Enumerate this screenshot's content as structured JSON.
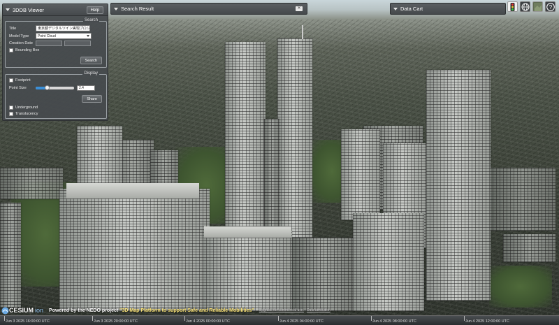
{
  "viewer": {
    "title": "3DDB Viewer",
    "help_label": "Help",
    "search": {
      "legend": "Search",
      "title_label": "Title",
      "title_value": "東京都デジタルツイン実現プロジェ",
      "model_type_label": "Model Type",
      "model_type_value": "Point Cloud",
      "creation_date_label": "Creation Date",
      "bounding_box_label": "Bounding Box",
      "search_button": "Search"
    },
    "display": {
      "legend": "Display",
      "footprint_label": "Footprint",
      "point_size_label": "Point Size",
      "point_size_value": "2.4",
      "point_size_fraction": 0.3,
      "share_button": "Share",
      "underground_label": "Underground",
      "translucency_label": "Translucency"
    }
  },
  "search_result": {
    "title": "Search Result"
  },
  "data_cart": {
    "title": "Data Cart"
  },
  "toolbar_icons": [
    "traffic-light-icon",
    "globe-icon",
    "layers-icon",
    "help-icon"
  ],
  "credits": {
    "cesium": "CESIUM",
    "ion": "ion",
    "nedo_prefix": "Powered by the NEDO project ",
    "nedo_highlight": "\"3D Map Platform to support Safe and Reliable Mobilities\"",
    "upgrade": "Upgrade for commercial use.",
    "data_attribution": "Data attribution"
  },
  "timeline": {
    "ticks": [
      "Jun 3 2025 16:00:00 UTC",
      "Jun 3 2025 20:00:00 UTC",
      "Jun 4 2025 00:00:00 UTC",
      "Jun 4 2025 04:00:00 UTC",
      "Jun 4 2025 08:00:00 UTC",
      "Jun 4 2025 12:00:00 UTC"
    ]
  }
}
